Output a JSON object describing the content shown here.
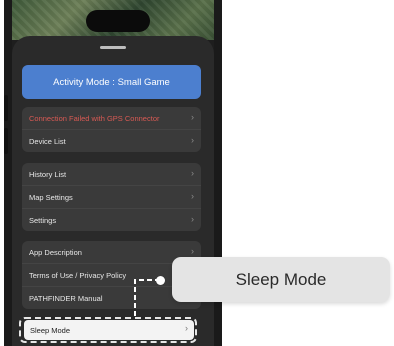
{
  "header": {
    "activity_mode_button": "Activity Mode : Small Game"
  },
  "menu": {
    "group1": [
      {
        "label": "Connection Failed with GPS Connector",
        "status": "error",
        "color": "#d85a54"
      },
      {
        "label": "Device List"
      }
    ],
    "group2": [
      {
        "label": "History List"
      },
      {
        "label": "Map Settings"
      },
      {
        "label": "Settings"
      }
    ],
    "group3": [
      {
        "label": "App Description"
      },
      {
        "label": "Terms of Use / Privacy Policy"
      },
      {
        "label": "PATHFINDER Manual"
      }
    ],
    "highlighted": {
      "label": "Sleep Mode"
    },
    "chevron": "›"
  },
  "callout": {
    "label": "Sleep Mode"
  },
  "colors": {
    "accent": "#4c7fcf",
    "error": "#d85a54",
    "sheet": "#2a2a2a"
  }
}
